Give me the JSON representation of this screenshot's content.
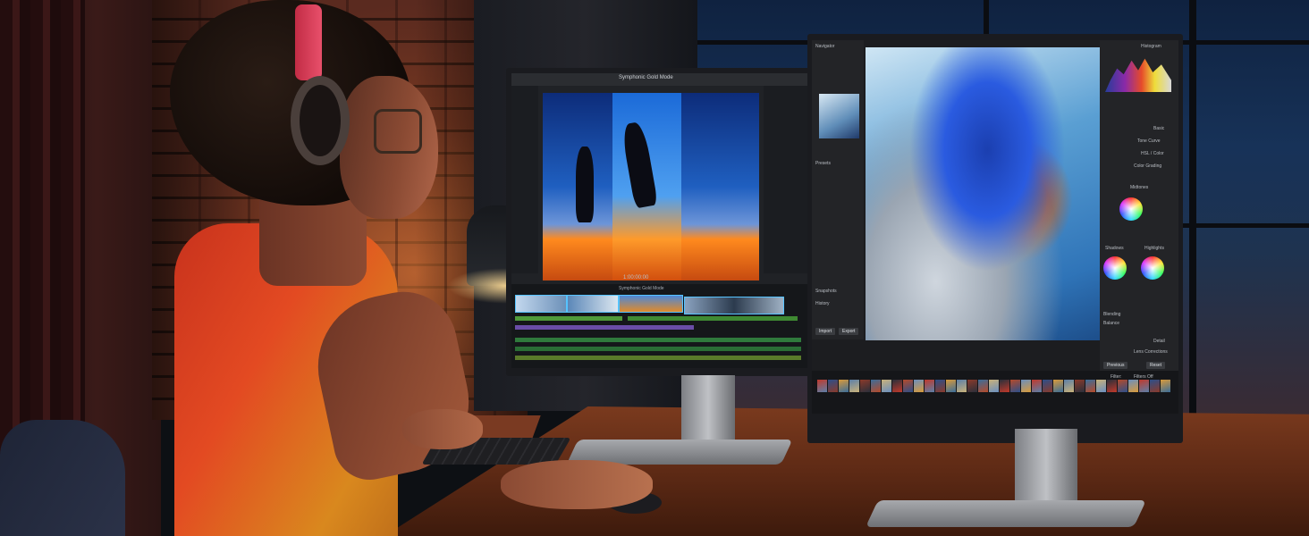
{
  "video_editor": {
    "title": "Symphonic Gold Mode",
    "timeline_title": "Symphonic Gold Mode",
    "timecode": "1:00:00:00"
  },
  "photo_editor": {
    "navigator_label": "Navigator",
    "presets_label": "Presets",
    "snapshots_label": "Snapshots",
    "history_label": "History",
    "import_button": "Import",
    "export_button": "Export",
    "panel_histogram": "Histogram",
    "panel_basic": "Basic",
    "panel_tone_curve": "Tone Curve",
    "panel_hsl": "HSL / Color",
    "panel_color_grading": "Color Grading",
    "panel_midtones": "Midtones",
    "panel_shadows": "Shadows",
    "panel_highlights": "Highlights",
    "panel_blending": "Blending",
    "panel_balance": "Balance",
    "panel_detail": "Detail",
    "panel_lens": "Lens Corrections",
    "previous_button": "Previous",
    "reset_button": "Reset",
    "filter_label": "Filter:",
    "filter_value": "Filters Off"
  },
  "colors": {
    "shirt": "#e34a22",
    "desk": "#5e2a15",
    "hood": "#2a5be0"
  }
}
